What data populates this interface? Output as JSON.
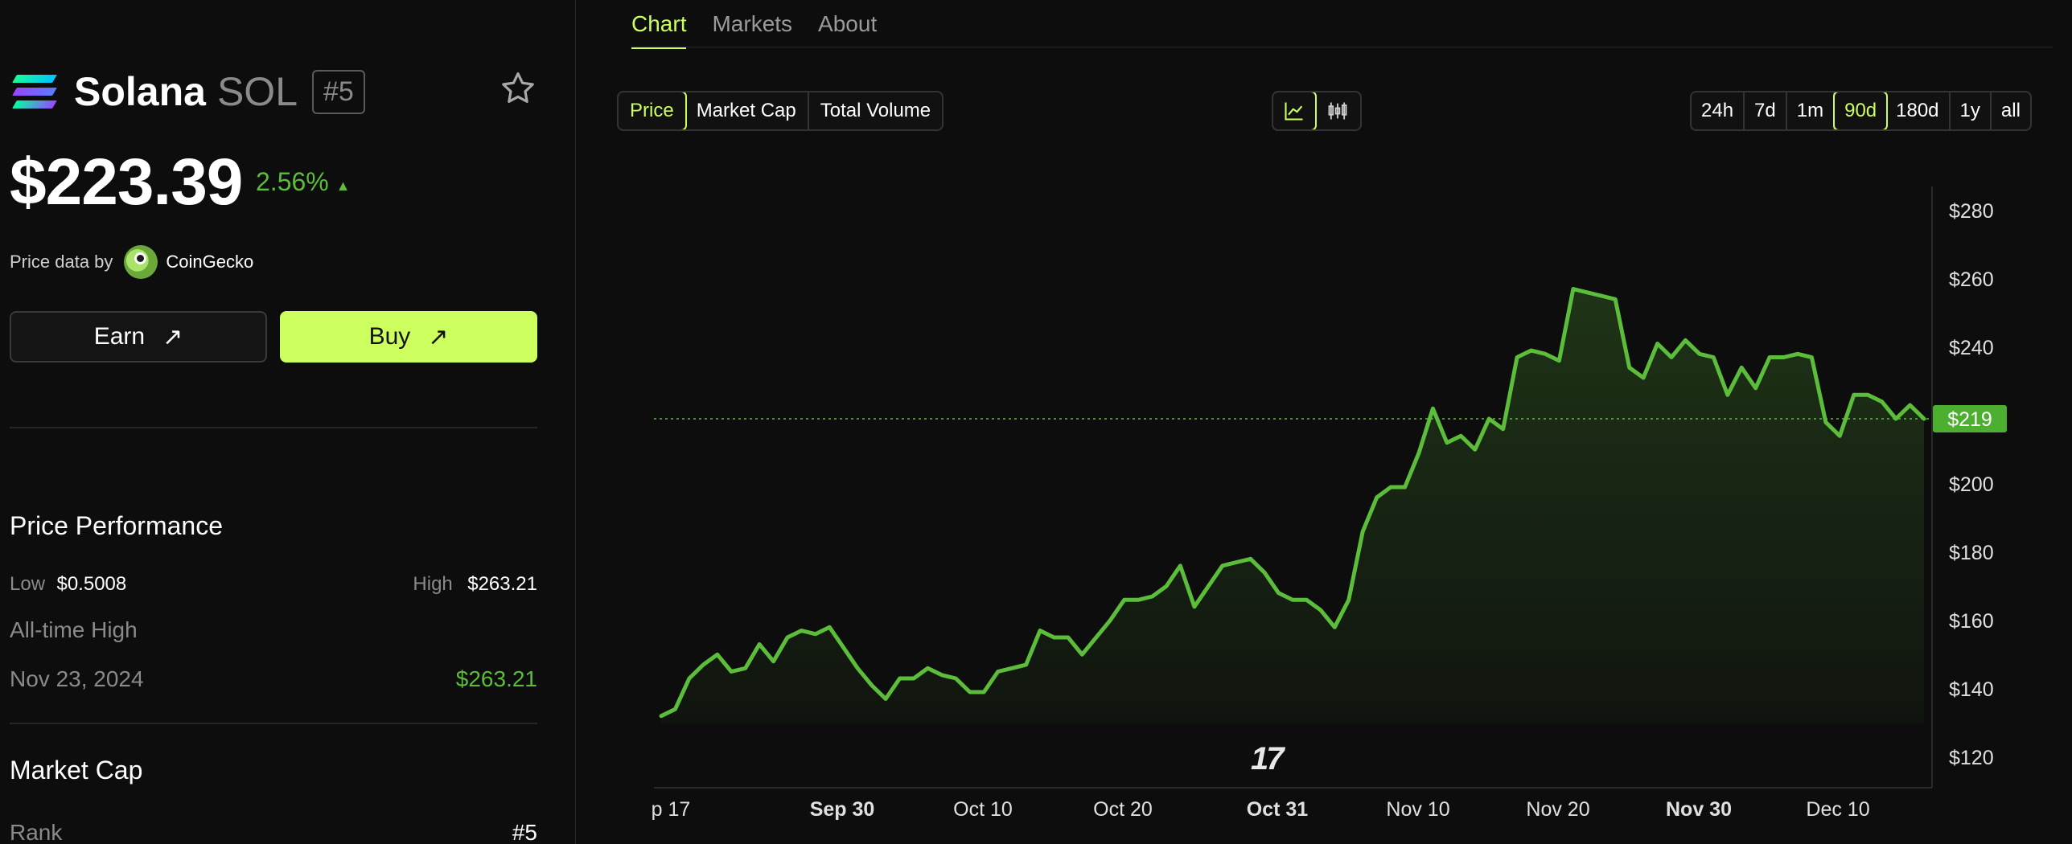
{
  "coin": {
    "name": "Solana",
    "symbol": "SOL",
    "rank": "#5",
    "price": "$223.39",
    "change": "2.56%",
    "change_arrow": "▲",
    "change_color": "#5cbd3a"
  },
  "price_source": {
    "prefix": "Price data by",
    "provider": "CoinGecko"
  },
  "actions": {
    "earn": "Earn",
    "buy": "Buy",
    "arrow": "↗"
  },
  "price_performance": {
    "title": "Price Performance",
    "low_label": "Low",
    "low_value": "$0.5008",
    "high_label": "High",
    "high_value": "$263.21",
    "ath_label": "All-time High",
    "ath_date": "Nov 23, 2024",
    "ath_value": "$263.21"
  },
  "market_cap": {
    "title": "Market Cap",
    "rank_label": "Rank",
    "rank_value": "#5"
  },
  "tabs": [
    {
      "label": "Chart",
      "active": true
    },
    {
      "label": "Markets",
      "active": false
    },
    {
      "label": "About",
      "active": false
    }
  ],
  "metric_toggle": {
    "options": [
      "Price",
      "Market Cap",
      "Total Volume"
    ],
    "selected": "Price"
  },
  "chart_type_toggle": {
    "options": [
      "line-chart-icon",
      "candlestick-icon"
    ],
    "selected": "line-chart-icon"
  },
  "range_toggle": {
    "options": [
      "24h",
      "7d",
      "1m",
      "90d",
      "180d",
      "1y",
      "all"
    ],
    "selected": "90d"
  },
  "colors": {
    "accent": "#ccff5e",
    "line": "#5cbd3a",
    "price_tag_bg": "#4caf2f",
    "background": "#0d0d0d"
  },
  "chart_data": {
    "type": "area",
    "x_tick_labels": [
      "p 17",
      "Sep 30",
      "Oct 10",
      "Oct 20",
      "Oct 31",
      "Nov 10",
      "Nov 20",
      "Nov 30",
      "Dec 10"
    ],
    "x_tick_bold": [
      false,
      true,
      false,
      false,
      true,
      false,
      false,
      true,
      false
    ],
    "y_tick_labels": [
      "$280",
      "$260",
      "$240",
      "$220",
      "$200",
      "$180",
      "$160",
      "$140",
      "$120"
    ],
    "ylim": [
      111,
      287
    ],
    "current_price_label": "$219",
    "current_price": 219,
    "series": [
      {
        "values": [
          132,
          134,
          143,
          147,
          150,
          145,
          146,
          153,
          148,
          155,
          157,
          156,
          158,
          152,
          146,
          141,
          137,
          143,
          143,
          146,
          144,
          143,
          139,
          139,
          145,
          146,
          147,
          157,
          155,
          155,
          150,
          155,
          160,
          166,
          166,
          167,
          170,
          176,
          164,
          170,
          176,
          177,
          178,
          174,
          168,
          166,
          166,
          163,
          158,
          166,
          186,
          196,
          199,
          199,
          209,
          222,
          212,
          214,
          210,
          219,
          216,
          237,
          239,
          238,
          236,
          257,
          256,
          255,
          254,
          234,
          231,
          241,
          237,
          242,
          238,
          237,
          226,
          234,
          228,
          237,
          237,
          238,
          237,
          218,
          214,
          226,
          226,
          224,
          219,
          223,
          219
        ]
      }
    ],
    "grid": false,
    "watermark": "TradingView"
  }
}
